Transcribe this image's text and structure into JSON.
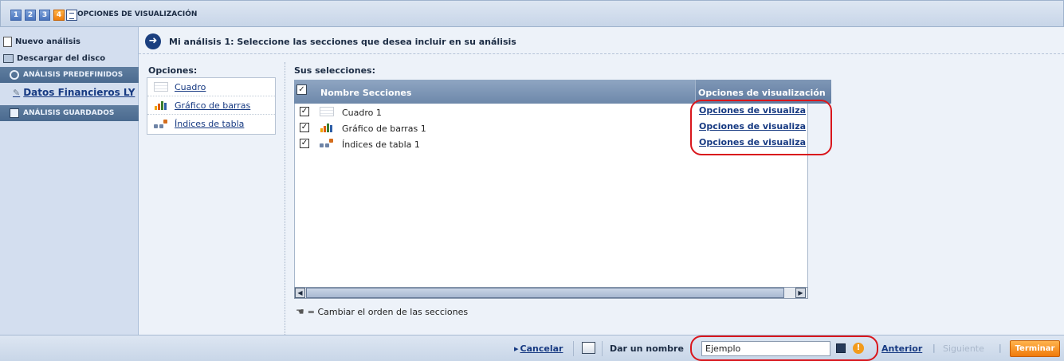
{
  "topbar": {
    "steps": [
      "1",
      "2",
      "3",
      "4"
    ],
    "active_step": "4",
    "title": "OPCIONES DE VISUALIZACIÓN"
  },
  "sidebar": {
    "new_analysis": "Nuevo análisis",
    "download": "Descargar del disco",
    "predefined": "ANÁLISIS PREDEFINIDOS",
    "predefined_item": "Datos Financieros LY",
    "saved": "ANÁLISIS GUARDADOS"
  },
  "main": {
    "title": "Mi análisis 1: Seleccione las secciones que desea incluir en su análisis",
    "options_label": "Opciones:",
    "options": [
      {
        "label": "Cuadro",
        "icon": "table-icon"
      },
      {
        "label": "Gráfico de barras",
        "icon": "bar-chart-icon"
      },
      {
        "label": "Índices de tabla",
        "icon": "table-index-icon"
      }
    ],
    "selections_label": "Sus selecciones:",
    "columns": {
      "name": "Nombre Secciones",
      "options": "Opciones de visualización"
    },
    "rows": [
      {
        "checked": true,
        "name": "Cuadro 1",
        "icon": "table-icon",
        "link": "Opciones de visualiza"
      },
      {
        "checked": true,
        "name": "Gráfico de barras 1",
        "icon": "bar-chart-icon",
        "link": "Opciones de visualiza"
      },
      {
        "checked": true,
        "name": "Índices de tabla 1",
        "icon": "table-index-icon",
        "link": "Opciones de visualiza"
      }
    ],
    "hint": "= Cambiar el orden de las secciones"
  },
  "footer": {
    "cancel": "Cancelar",
    "name_label": "Dar un nombre",
    "name_value": "Ejemplo",
    "prev": "Anterior",
    "next": "Siguiente",
    "finish": "Terminar"
  },
  "colors": {
    "accent_orange": "#f07a0a",
    "annotation_red": "#d9161c",
    "link_blue": "#173a82"
  }
}
